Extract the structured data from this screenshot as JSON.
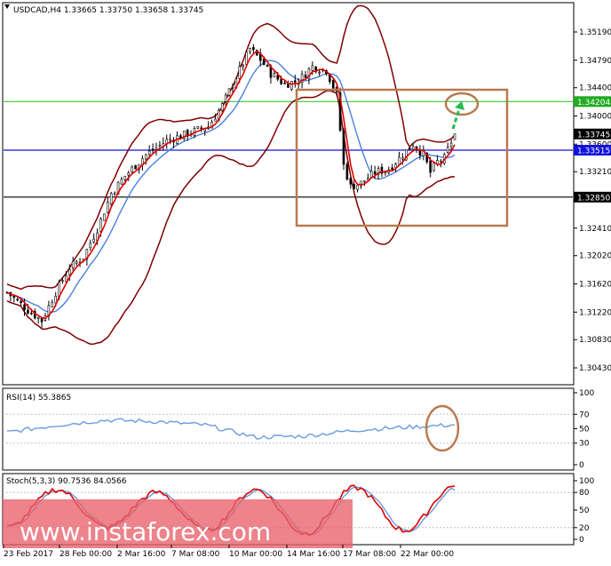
{
  "main_panel": {
    "title": "USDCAD,H4  1.33665 1.33750 1.33658 1.33745",
    "ylim": [
      1.3043,
      1.3519
    ],
    "y_ticks": [
      "1.35190",
      "1.34790",
      "1.34400",
      "1.34000",
      "1.33600",
      "1.33210",
      "1.32410",
      "1.32020",
      "1.31620",
      "1.31220",
      "1.30830",
      "1.30430"
    ],
    "y_tick_values": [
      1.3519,
      1.3479,
      1.344,
      1.34,
      1.336,
      1.3321,
      1.3241,
      1.3202,
      1.3162,
      1.3122,
      1.3083,
      1.3043
    ],
    "level_badges": [
      {
        "label": "1.34204",
        "value": 1.34204,
        "bg": "#22aa22",
        "fg": "#ffffff",
        "line": "#33cc33"
      },
      {
        "label": "1.33745",
        "value": 1.33745,
        "bg": "#000000",
        "fg": "#ffffff",
        "line": null
      },
      {
        "label": "1.33515",
        "value": 1.33515,
        "bg": "#1010dd",
        "fg": "#ffffff",
        "line": "#1010dd"
      },
      {
        "label": "1.32850",
        "value": 1.3285,
        "bg": "#000000",
        "fg": "#ffffff",
        "line": "#000000"
      }
    ]
  },
  "rsi_panel": {
    "title": "RSI(14) 55.3865",
    "ylim": [
      0,
      100
    ],
    "y_ticks": [
      "100",
      "70",
      "50",
      "30",
      "0"
    ],
    "y_tick_values": [
      100,
      70,
      50,
      30,
      0
    ]
  },
  "stoch_panel": {
    "title": "Stoch(5,3,3) 90.7536 84.0566",
    "ylim": [
      0,
      100
    ],
    "y_ticks": [
      "100",
      "80",
      "50",
      "20",
      "0"
    ],
    "y_tick_values": [
      100,
      80,
      50,
      20,
      0
    ]
  },
  "x_labels": [
    "23 Feb 2017",
    "28 Feb 00:00",
    "2 Mar 16:00",
    "7 Mar 08:00",
    "10 Mar 00:00",
    "14 Mar 16:00",
    "17 Mar 08:00",
    "22 Mar 00:00"
  ],
  "watermark": "www.instaforex.com",
  "colors": {
    "candle": "#000000",
    "ma_red": "#e00000",
    "ma_blue": "#4a7fe0",
    "bollinger": "#800000",
    "rsi_line": "#6a9be0",
    "stoch_main": "#e00000",
    "stoch_signal": "#6a9be0",
    "annotation_box": "#b87a50",
    "arrow": "#22bb55"
  },
  "chart_data": {
    "type": "line",
    "title": "USDCAD,H4  1.33665 1.33750 1.33658 1.33745",
    "symbol": "USDCAD",
    "timeframe": "H4",
    "x": [
      "23 Feb 2017",
      "28 Feb 00:00",
      "2 Mar 16:00",
      "7 Mar 08:00",
      "10 Mar 00:00",
      "14 Mar 16:00",
      "17 Mar 08:00",
      "22 Mar 00:00"
    ],
    "series": [
      {
        "name": "price",
        "values": [
          1.3135,
          1.312,
          1.333,
          1.342,
          1.3485,
          1.3455,
          1.3295,
          1.3335,
          1.3365,
          1.33,
          1.3375
        ]
      },
      {
        "name": "RSI(14)",
        "values": [
          45,
          55,
          62,
          60,
          55,
          38,
          40,
          48,
          52,
          55.3865
        ]
      },
      {
        "name": "Stoch(5,3,3)",
        "values": [
          20,
          85,
          20,
          80,
          15,
          85,
          10,
          88,
          15,
          90.7536
        ]
      }
    ],
    "levels": [
      1.34204,
      1.33745,
      1.33515,
      1.3285
    ],
    "ylim": [
      1.3043,
      1.3519
    ]
  }
}
